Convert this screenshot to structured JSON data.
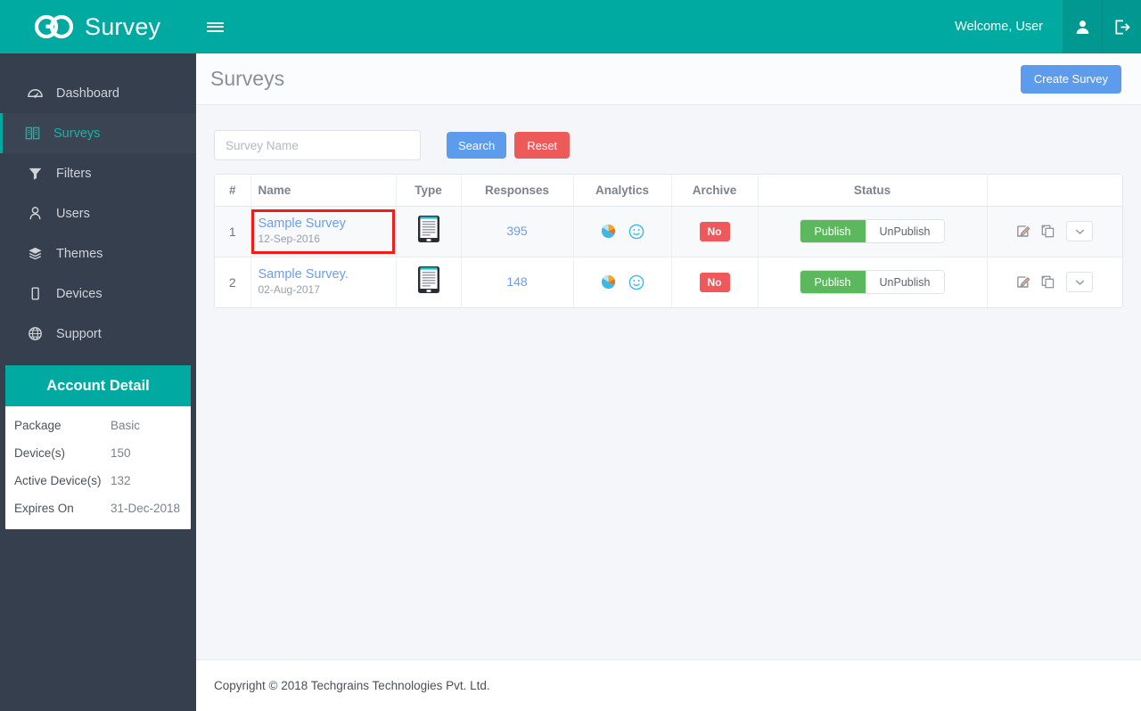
{
  "brand": {
    "name": "Survey",
    "logo_icon": "go-infinity-logo-icon",
    "menu_icon": "hamburger-menu-icon"
  },
  "topbar": {
    "welcome": "Welcome, User",
    "user_icon": "user-icon",
    "logout_icon": "logout-icon",
    "bg_color": "#00aaa0",
    "icon_bg_color": "#009890"
  },
  "sidebar": {
    "bg_color": "#363f4d",
    "active_color": "#17b3a3",
    "items": [
      {
        "label": "Dashboard",
        "icon": "dashboard-icon",
        "active": false
      },
      {
        "label": "Surveys",
        "icon": "book-icon",
        "active": true
      },
      {
        "label": "Filters",
        "icon": "funnel-icon",
        "active": false
      },
      {
        "label": "Users",
        "icon": "users-icon",
        "active": false
      },
      {
        "label": "Themes",
        "icon": "layers-icon",
        "active": false
      },
      {
        "label": "Devices",
        "icon": "tablet-icon",
        "active": false
      },
      {
        "label": "Support",
        "icon": "globe-icon",
        "active": false
      }
    ]
  },
  "account_detail": {
    "title": "Account Detail",
    "rows": [
      {
        "key": "Package",
        "value": "Basic"
      },
      {
        "key": "Device(s)",
        "value": "150"
      },
      {
        "key": "Active Device(s)",
        "value": "132"
      },
      {
        "key": "Expires On",
        "value": "31-Dec-2018"
      }
    ]
  },
  "page": {
    "title": "Surveys",
    "create_button": "Create Survey",
    "create_button_color": "#5d9cec"
  },
  "search": {
    "placeholder": "Survey Name",
    "value": "",
    "search_label": "Search",
    "reset_label": "Reset",
    "search_color": "#5d9cec",
    "reset_color": "#ee5a5a"
  },
  "table": {
    "headers": [
      "#",
      "Name",
      "Type",
      "Responses",
      "Analytics",
      "Archive",
      "Status",
      ""
    ],
    "rows": [
      {
        "index": "1",
        "name": "Sample Survey",
        "date": "12-Sep-2016",
        "highlighted": true,
        "type_icon": "tablet-survey-icon",
        "responses": "395",
        "analytics_icons": [
          "pie-chart-icon",
          "smiley-icon"
        ],
        "archive": "No",
        "status_on": "Publish",
        "status_off": "UnPublish",
        "status_active": "Publish",
        "actions": [
          "edit-icon",
          "copy-icon",
          "chevron-down-icon"
        ]
      },
      {
        "index": "2",
        "name": "Sample Survey.",
        "date": "02-Aug-2017",
        "highlighted": false,
        "type_icon": "tablet-survey-icon",
        "responses": "148",
        "analytics_icons": [
          "pie-chart-icon",
          "smiley-icon"
        ],
        "archive": "No",
        "status_on": "Publish",
        "status_off": "UnPublish",
        "status_active": "Publish",
        "actions": [
          "edit-icon",
          "copy-icon",
          "chevron-down-icon"
        ]
      }
    ],
    "highlight_color": "#f01c1c",
    "archive_badge_color": "#f0595b",
    "publish_color": "#5cb85c",
    "link_color": "#6d9eeb"
  },
  "footer": {
    "copyright": "Copyright © 2018 Techgrains Technologies Pvt. Ltd."
  }
}
